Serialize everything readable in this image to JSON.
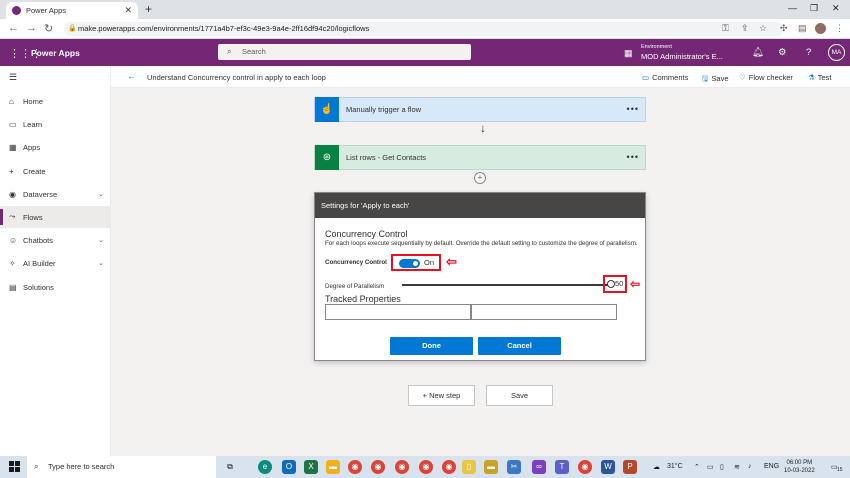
{
  "browser": {
    "tab_title": "Power Apps",
    "url": "make.powerapps.com/environments/1771a4b7-ef3c-49e3-9a4e-2ff16df94c20/logicflows"
  },
  "app": {
    "name": "Power Apps",
    "search_placeholder": "Search",
    "env_label": "Environment",
    "env_name": "MOD Administrator's E...",
    "avatar_initials": "MA"
  },
  "sidebar": {
    "items": [
      {
        "label": "Home",
        "icon": "home-icon"
      },
      {
        "label": "Learn",
        "icon": "book-icon"
      },
      {
        "label": "Apps",
        "icon": "apps-icon"
      },
      {
        "label": "Create",
        "icon": "plus-icon"
      },
      {
        "label": "Dataverse",
        "icon": "database-icon",
        "expandable": true
      },
      {
        "label": "Flows",
        "icon": "flow-icon",
        "active": true
      },
      {
        "label": "Chatbots",
        "icon": "chatbot-icon",
        "expandable": true
      },
      {
        "label": "AI Builder",
        "icon": "ai-icon",
        "expandable": true
      },
      {
        "label": "Solutions",
        "icon": "solutions-icon"
      }
    ]
  },
  "command_bar": {
    "flow_title": "Understand Concurrency control in apply to each loop",
    "comments": "Comments",
    "save": "Save",
    "flow_checker": "Flow checker",
    "test": "Test"
  },
  "flow": {
    "trigger": "Manually trigger a flow",
    "list_rows": "List rows - Get Contacts",
    "dots": "•••"
  },
  "settings": {
    "header": "Settings for 'Apply to each'",
    "cc_title": "Concurrency Control",
    "cc_desc": "For each loops execute sequentially by default. Override the default setting to customize the degree of parallelism.",
    "cc_label": "Concurrency Control",
    "toggle_state": "On",
    "dop_label": "Degree of Parallelism",
    "dop_value": "50",
    "tracked_title": "Tracked Properties",
    "done": "Done",
    "cancel": "Cancel"
  },
  "bottom": {
    "new_step": "+ New step",
    "save": "Save"
  },
  "taskbar": {
    "search_placeholder": "Type here to search",
    "temperature": "31°C",
    "language": "ENG",
    "time": "06:00 PM",
    "date": "10-03-2022",
    "notification_count": "15"
  },
  "colors": {
    "brand": "#742774",
    "accent": "#0078d4",
    "highlight": "#e81123"
  }
}
